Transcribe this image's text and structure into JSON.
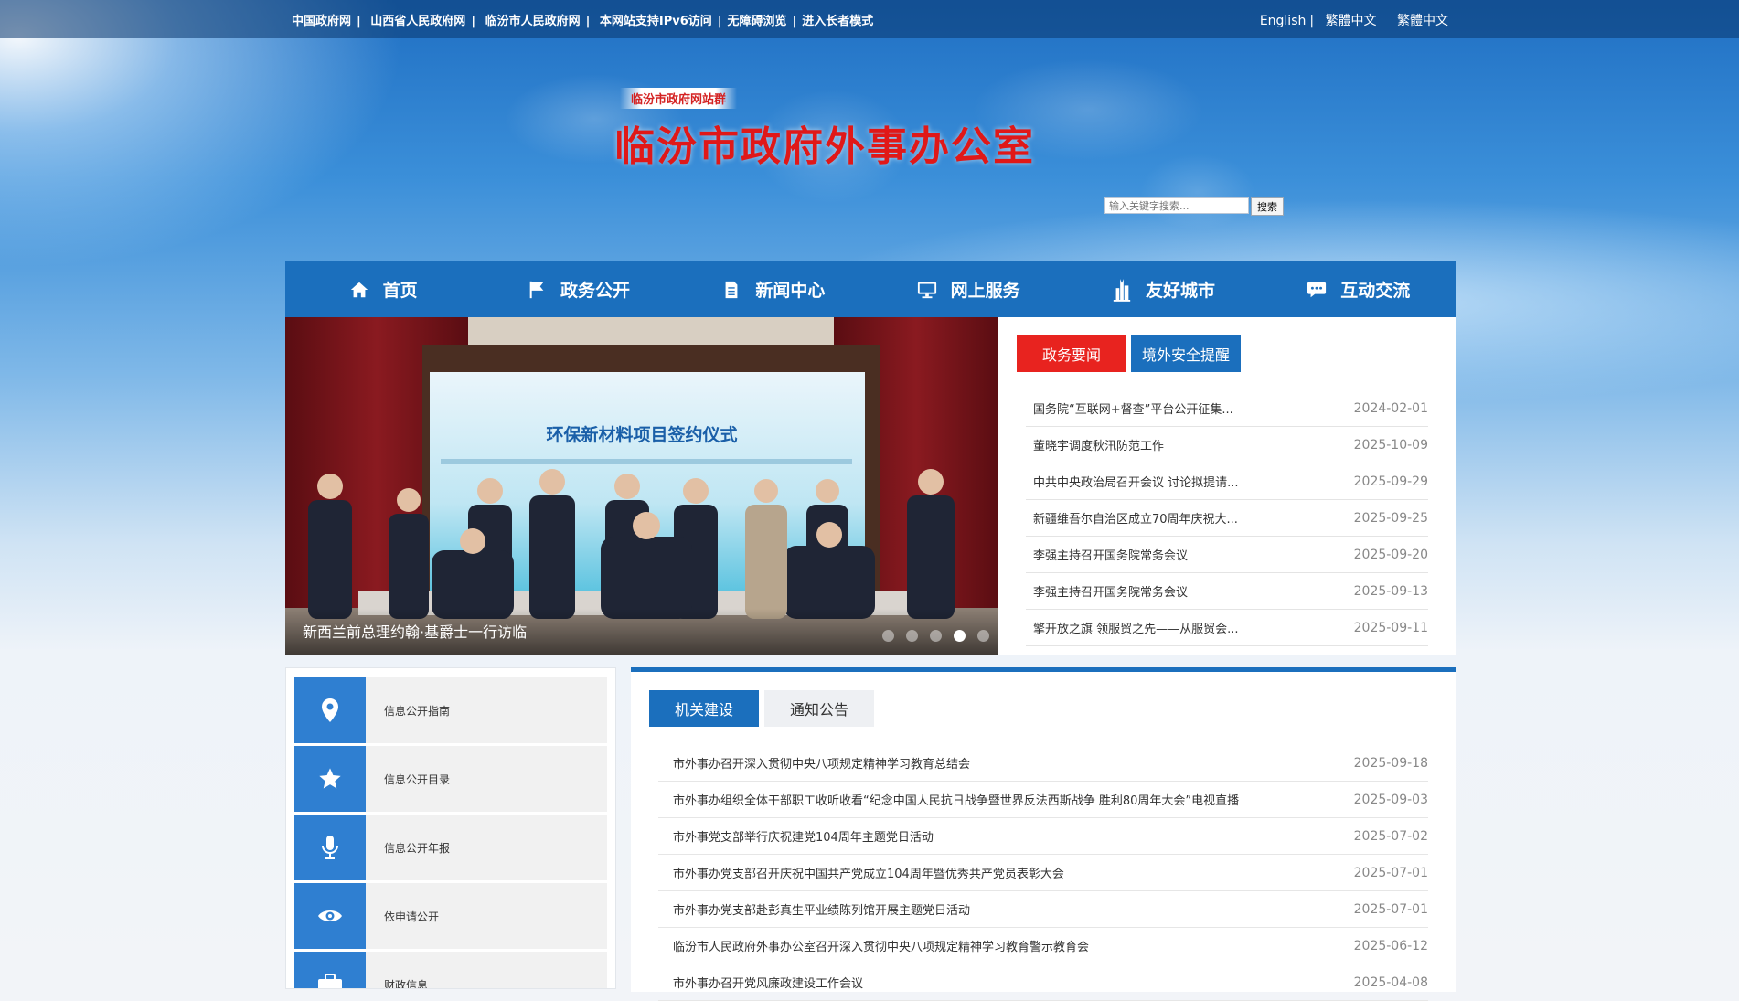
{
  "topbar": {
    "links": [
      "中国政府网",
      "山西省人民政府网",
      "临汾市人民政府网",
      "本网站支持IPv6访问",
      "无障碍浏览",
      "进入长者模式"
    ],
    "languages": [
      "English",
      "繁體中文",
      "繁體中文"
    ]
  },
  "header": {
    "badge": "临汾市政府网站群",
    "title": "临汾市政府外事办公室"
  },
  "search": {
    "placeholder": "输入关键字搜索...",
    "button": "搜索"
  },
  "nav": [
    {
      "label": "首页",
      "icon": "home-icon"
    },
    {
      "label": "政务公开",
      "icon": "flag-icon"
    },
    {
      "label": "新闻中心",
      "icon": "document-icon"
    },
    {
      "label": "网上服务",
      "icon": "monitor-icon"
    },
    {
      "label": "友好城市",
      "icon": "building-icon"
    },
    {
      "label": "互动交流",
      "icon": "chat-icon"
    }
  ],
  "carousel": {
    "caption": "新西兰前总理约翰·基爵士一行访临",
    "slide_banner": "环保新材料项目签约仪式",
    "active_index": 3,
    "dot_count": 5
  },
  "news_panel": {
    "tabs": [
      "政务要闻",
      "境外安全提醒"
    ],
    "items": [
      {
        "title": "国务院“互联网+督查”平台公开征集...",
        "date": "2024-02-01"
      },
      {
        "title": "董晓宇调度秋汛防范工作",
        "date": "2025-10-09"
      },
      {
        "title": "中共中央政治局召开会议 讨论拟提请...",
        "date": "2025-09-29"
      },
      {
        "title": "新疆维吾尔自治区成立70周年庆祝大...",
        "date": "2025-09-25"
      },
      {
        "title": "李强主持召开国务院常务会议",
        "date": "2025-09-20"
      },
      {
        "title": "李强主持召开国务院常务会议",
        "date": "2025-09-13"
      },
      {
        "title": "擎开放之旗 领服贸之先——从服贸会...",
        "date": "2025-09-11"
      }
    ]
  },
  "left_menu": [
    {
      "label": "信息公开指南",
      "icon": "location-pin-icon"
    },
    {
      "label": "信息公开目录",
      "icon": "star-icon"
    },
    {
      "label": "信息公开年报",
      "icon": "microphone-icon"
    },
    {
      "label": "依申请公开",
      "icon": "eye-icon"
    },
    {
      "label": "财政信息",
      "icon": "briefcase-icon"
    }
  ],
  "bottom_panel": {
    "tabs": [
      "机关建设",
      "通知公告"
    ],
    "items": [
      {
        "title": "市外事办召开深入贯彻中央八项规定精神学习教育总结会",
        "date": "2025-09-18"
      },
      {
        "title": "市外事办组织全体干部职工收听收看“纪念中国人民抗日战争暨世界反法西斯战争 胜利80周年大会”电视直播",
        "date": "2025-09-03"
      },
      {
        "title": "市外事党支部举行庆祝建党104周年主题党日活动",
        "date": "2025-07-02"
      },
      {
        "title": "市外事办党支部召开庆祝中国共产党成立104周年暨优秀共产党员表彰大会",
        "date": "2025-07-01"
      },
      {
        "title": "市外事办党支部赴彭真生平业绩陈列馆开展主题党日活动",
        "date": "2025-07-01"
      },
      {
        "title": "临汾市人民政府外事办公室召开深入贯彻中央八项规定精神学习教育警示教育会",
        "date": "2025-06-12"
      },
      {
        "title": "市外事办召开党风廉政建设工作会议",
        "date": "2025-04-08"
      }
    ]
  },
  "colors": {
    "nav_blue": "#1b6fbd",
    "accent_red": "#e8231f",
    "title_red": "#e01818"
  }
}
